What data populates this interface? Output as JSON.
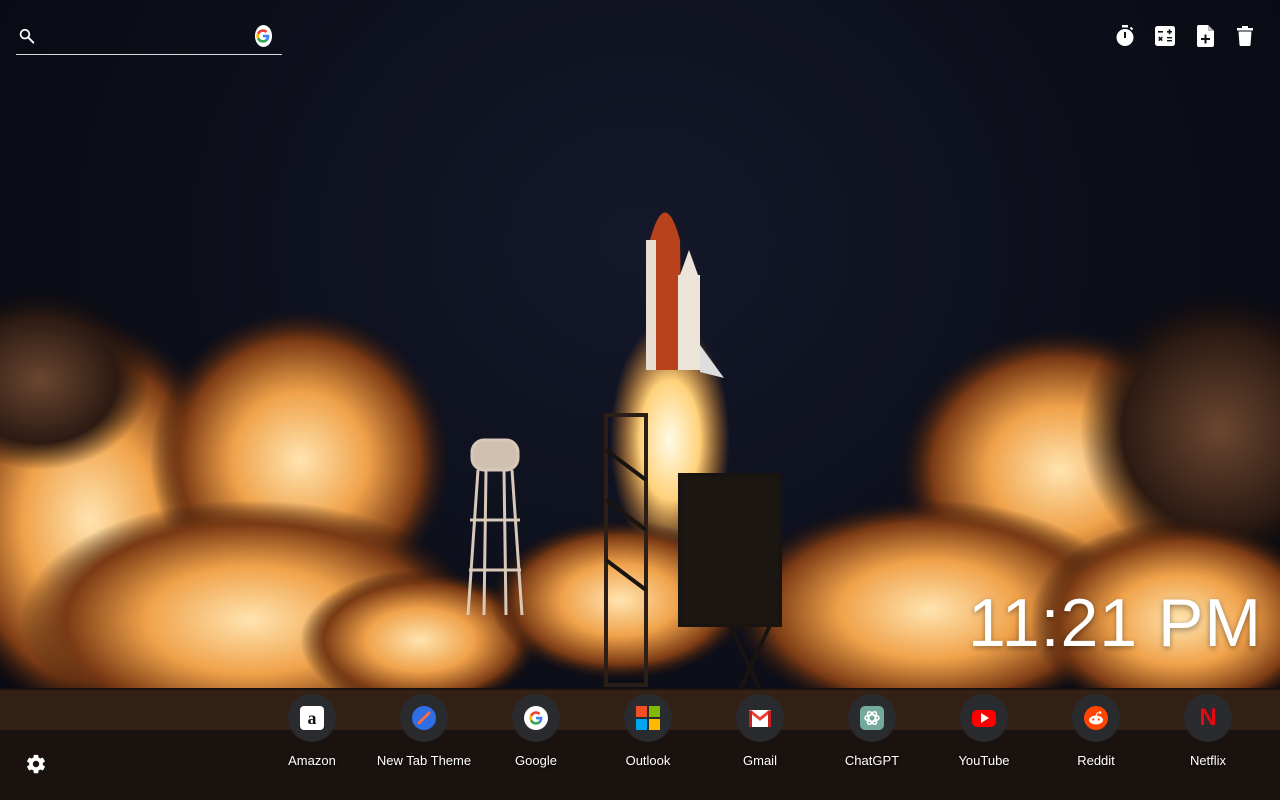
{
  "search": {
    "placeholder": "",
    "value": "",
    "engine_icon": "google-icon"
  },
  "tools": [
    {
      "name": "timer-icon"
    },
    {
      "name": "calculator-icon"
    },
    {
      "name": "add-note-icon"
    },
    {
      "name": "trash-icon"
    }
  ],
  "clock": {
    "time": "11:21 PM"
  },
  "shortcuts": [
    {
      "label": "Amazon",
      "icon": "amazon-icon"
    },
    {
      "label": "New Tab Theme",
      "icon": "new-tab-theme-icon"
    },
    {
      "label": "Google",
      "icon": "google-icon"
    },
    {
      "label": "Outlook",
      "icon": "outlook-icon"
    },
    {
      "label": "Gmail",
      "icon": "gmail-icon"
    },
    {
      "label": "ChatGPT",
      "icon": "chatgpt-icon"
    },
    {
      "label": "YouTube",
      "icon": "youtube-icon"
    },
    {
      "label": "Reddit",
      "icon": "reddit-icon"
    },
    {
      "label": "Netflix",
      "icon": "netflix-icon"
    }
  ],
  "settings": {
    "icon": "gear-icon"
  },
  "colors": {
    "youtube": "#ff0000",
    "netflix": "#e50914",
    "reddit": "#ff4500",
    "chatgpt": "#74aa9c",
    "new_tab_theme": "#2f6ee5"
  }
}
